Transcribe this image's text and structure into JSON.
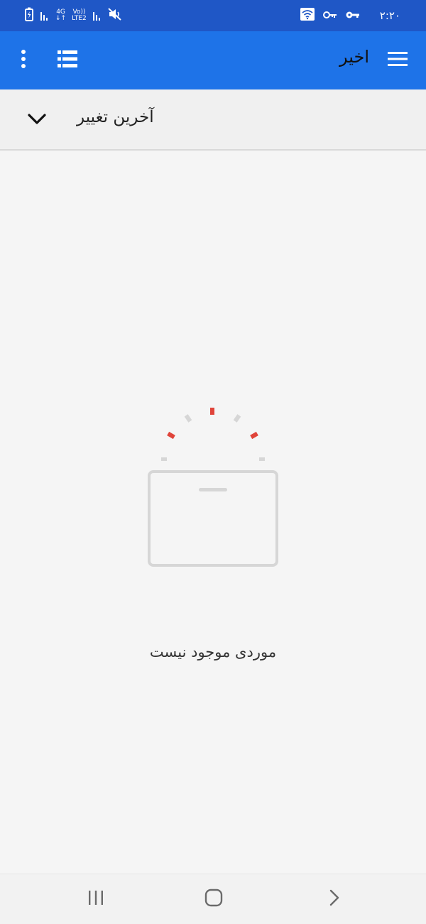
{
  "status_bar": {
    "time": "۲:۲۰",
    "net_top": "4G",
    "net_volte_top": "Vo))",
    "net_volte_bottom": "LTE2",
    "icons": [
      "battery-saver-icon",
      "signal-icon",
      "network-4g-icon",
      "signal-icon",
      "mute-icon",
      "wifi-icon",
      "vpn-key-icon",
      "key-icon"
    ]
  },
  "app_bar": {
    "title": "اخیر",
    "icons": [
      "more-vert-icon",
      "list-view-icon",
      "menu-icon"
    ],
    "color": "#1e73e8"
  },
  "sort_bar": {
    "label": "آخرین تغییر",
    "icon": "chevron-down-icon"
  },
  "empty_state": {
    "message": "موردی موجود نیست",
    "icon": "empty-box-icon",
    "accent_color": "#e0443a"
  },
  "nav_bar": {
    "icons": [
      "recent-apps-icon",
      "home-icon",
      "back-icon"
    ]
  }
}
